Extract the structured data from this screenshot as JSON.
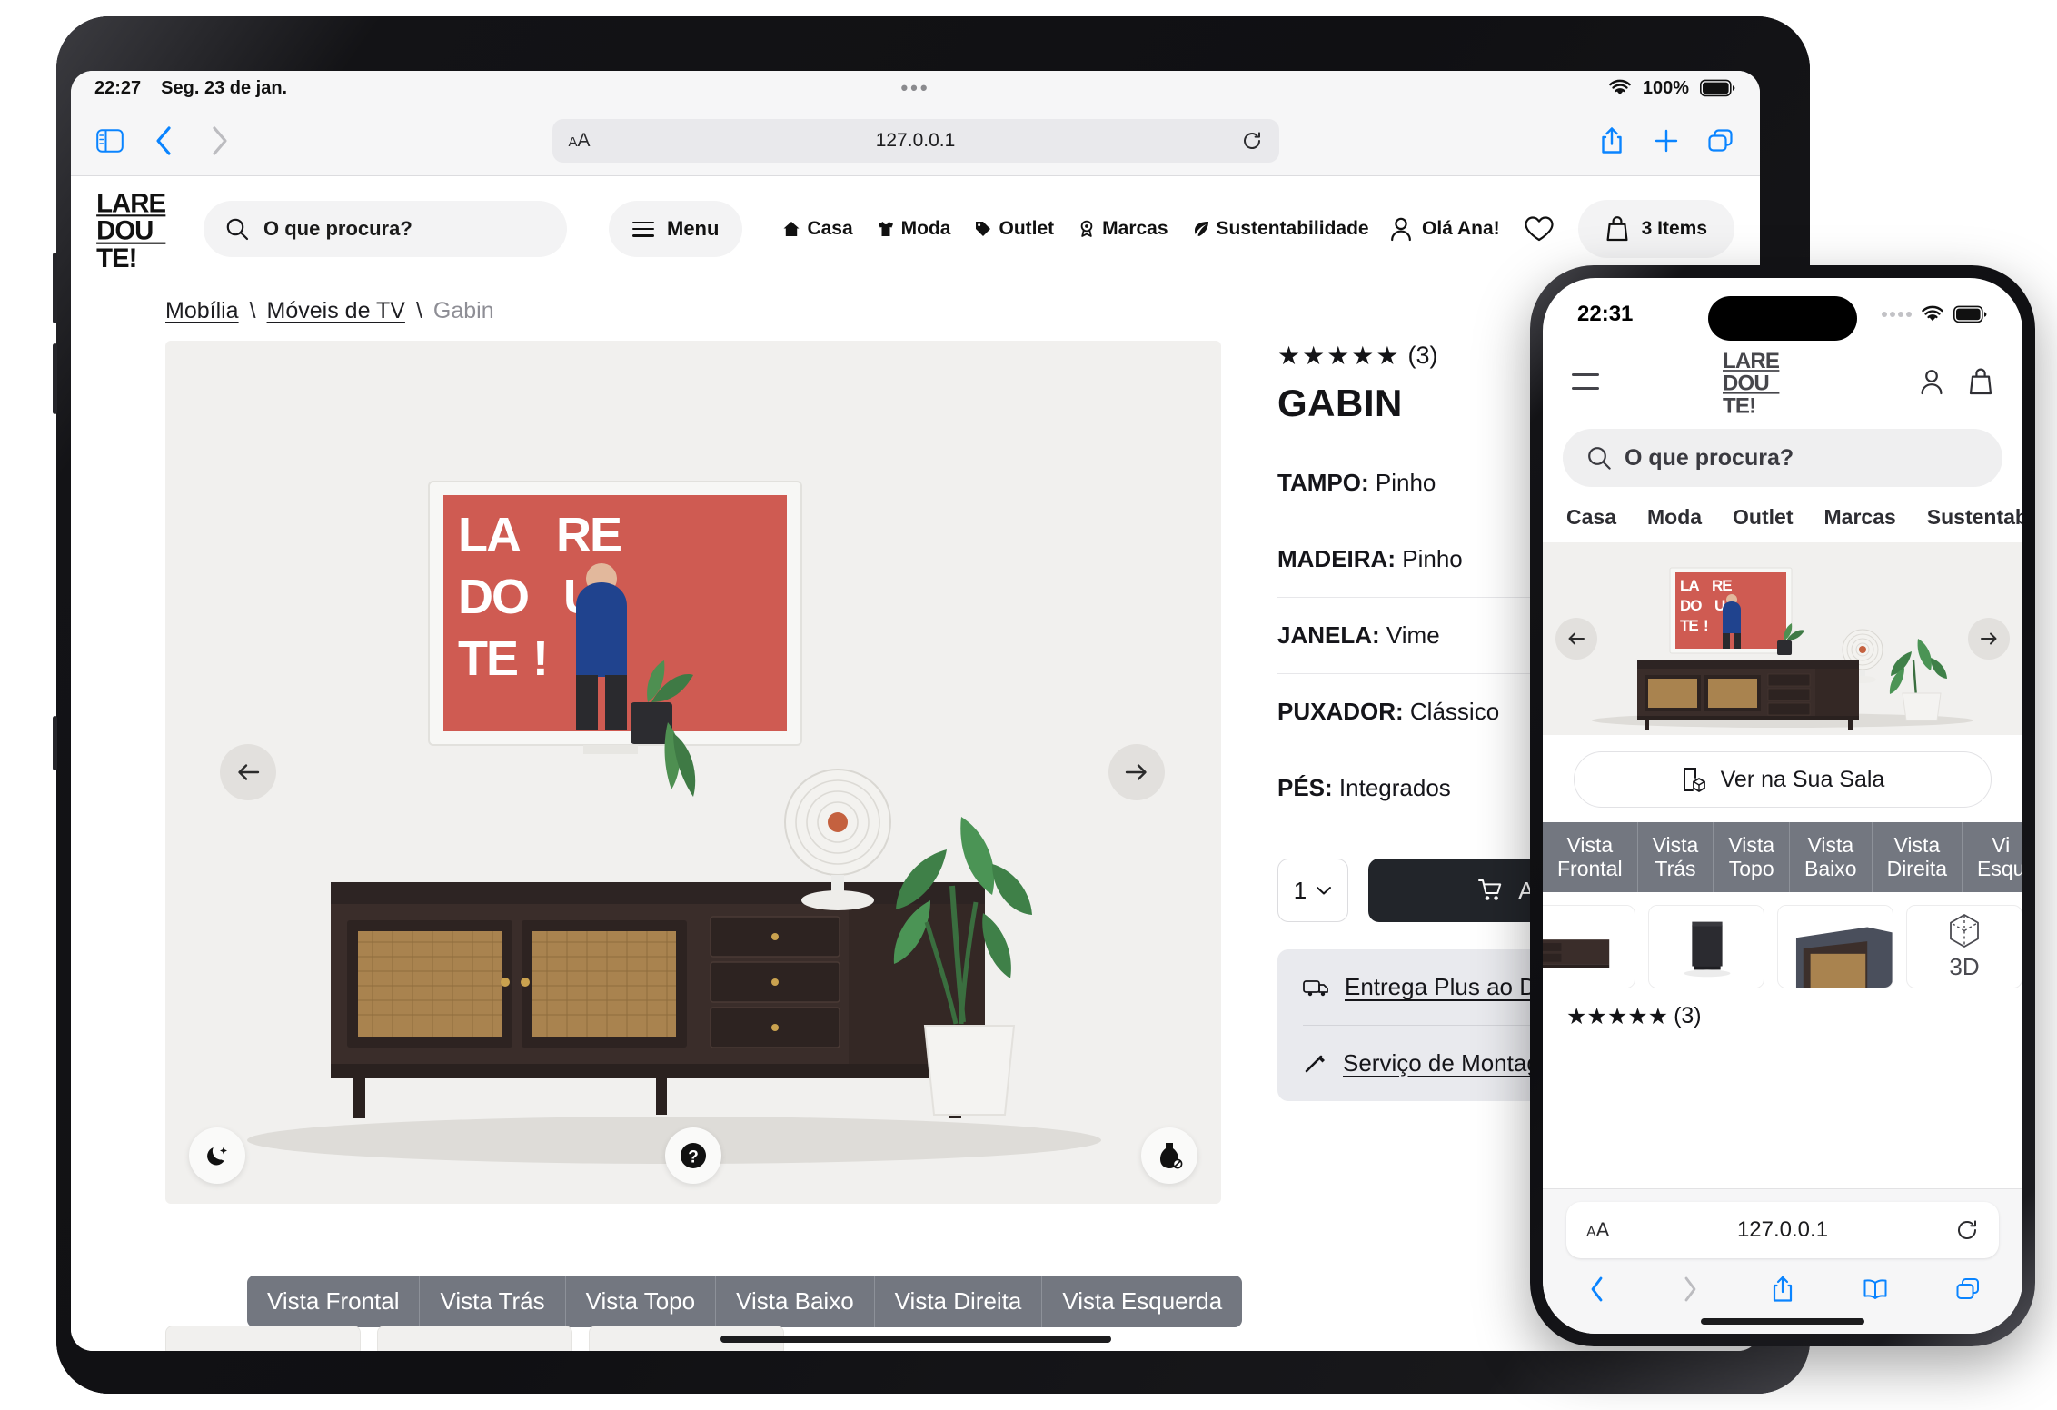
{
  "ipad": {
    "status_bar": {
      "time": "22:27",
      "date": "Seg. 23 de jan.",
      "battery_pct": "100%",
      "wifi_icon": "wifi-icon",
      "battery_icon": "battery-icon"
    },
    "safari_toolbar": {
      "sidebar_icon": "sidebar-icon",
      "back_icon": "chevron-left-icon",
      "forward_icon": "chevron-right-icon",
      "aa_label": "AA",
      "url": "127.0.0.1",
      "reload_icon": "reload-icon",
      "share_icon": "share-icon",
      "new_tab_icon": "plus-icon",
      "tabs_icon": "tabs-icon"
    },
    "header": {
      "logo_lines": [
        "LARE",
        "DOU",
        "TE!"
      ],
      "search_placeholder": "O que procura?",
      "search_icon": "search-icon",
      "menu_label": "Menu",
      "menu_icon": "hamburger-icon",
      "nav": [
        {
          "label": "Casa",
          "icon": "home-icon"
        },
        {
          "label": "Moda",
          "icon": "tshirt-icon"
        },
        {
          "label": "Outlet",
          "icon": "tag-icon"
        },
        {
          "label": "Marcas",
          "icon": "badge-icon"
        },
        {
          "label": "Sustentabilidade",
          "icon": "leaf-icon"
        }
      ],
      "account_label": "Olá Ana!",
      "account_icon": "user-icon",
      "wishlist_icon": "heart-icon",
      "cart_label": "3 Items",
      "cart_icon": "bag-icon"
    },
    "breadcrumb": {
      "items": [
        "Mobília",
        "Móveis de TV"
      ],
      "current": "Gabin",
      "separator": "\\"
    },
    "gallery": {
      "prev_icon": "arrow-left-icon",
      "next_icon": "arrow-right-icon",
      "night_icon": "moon-sparkle-icon",
      "help_icon": "question-mark-icon",
      "material_icon": "vase-icon",
      "tv_screen_text": [
        "LA",
        "RE",
        "DO",
        "U",
        "TE",
        "!"
      ]
    },
    "product": {
      "stars": "★★★★★",
      "rating_count": "(3)",
      "title": "GABIN",
      "price": "€",
      "specs": [
        {
          "key": "TAMPO:",
          "value": "Pinho"
        },
        {
          "key": "MADEIRA:",
          "value": "Pinho"
        },
        {
          "key": "JANELA:",
          "value": "Vime"
        },
        {
          "key": "PUXADOR:",
          "value": "Clássico"
        },
        {
          "key": "PÉS:",
          "value": "Integrados"
        }
      ],
      "quantity": "1",
      "quantity_chevron": "chevron-down-icon",
      "add_to_cart_label": "Adicionar ao",
      "cart_icon": "cart-icon",
      "services": [
        {
          "label": "Entrega Plus ao Do",
          "icon": "truck-icon"
        },
        {
          "label": "Serviço de Montagem",
          "icon": "wrench-icon"
        }
      ]
    },
    "view_tabs": [
      "Vista Frontal",
      "Vista Trás",
      "Vista Topo",
      "Vista Baixo",
      "Vista Direita",
      "Vista Esquerda"
    ]
  },
  "iphone": {
    "status_bar": {
      "time": "22:31",
      "signal_icon": "signal-dots-icon",
      "wifi_icon": "wifi-icon",
      "battery_icon": "battery-icon"
    },
    "header": {
      "menu_icon": "hamburger-icon",
      "logo_lines": [
        "LARE",
        "DOU",
        "TE!"
      ],
      "account_icon": "user-icon",
      "bag_icon": "bag-icon"
    },
    "search_placeholder": "O que procura?",
    "search_icon": "search-icon",
    "nav": [
      "Casa",
      "Moda",
      "Outlet",
      "Marcas",
      "Sustentabi"
    ],
    "gallery": {
      "prev_icon": "arrow-left-icon",
      "next_icon": "arrow-right-icon"
    },
    "ar_button": {
      "label": "Ver na Sua Sala",
      "icon": "ar-cube-icon"
    },
    "view_tabs": [
      "Vista\nFrontal",
      "Vista\nTrás",
      "Vista\nTopo",
      "Vista\nBaixo",
      "Vista\nDireita",
      "Vi\nEsqu"
    ],
    "thumbnails": [
      {
        "name": "thumbnail-front"
      },
      {
        "name": "thumbnail-side"
      },
      {
        "name": "thumbnail-corner"
      },
      {
        "name": "thumbnail-3d",
        "label": "3D",
        "icon": "cube-3d-icon"
      }
    ],
    "rating": {
      "stars": "★★★★★",
      "count": "(3)"
    },
    "safari": {
      "aa_label": "AA",
      "url": "127.0.0.1",
      "reload_icon": "reload-icon",
      "back_icon": "chevron-left-icon",
      "forward_icon": "chevron-right-icon",
      "share_icon": "share-icon",
      "bookmarks_icon": "book-icon",
      "tabs_icon": "tabs-icon"
    }
  },
  "colors": {
    "accent_blue": "#0a84ff",
    "dark_button": "#22252a",
    "tab_grey": "#737780",
    "gallery_bg": "#f1f0ee",
    "services_bg": "#e9eaee",
    "tv_red": "#cf5b52"
  }
}
